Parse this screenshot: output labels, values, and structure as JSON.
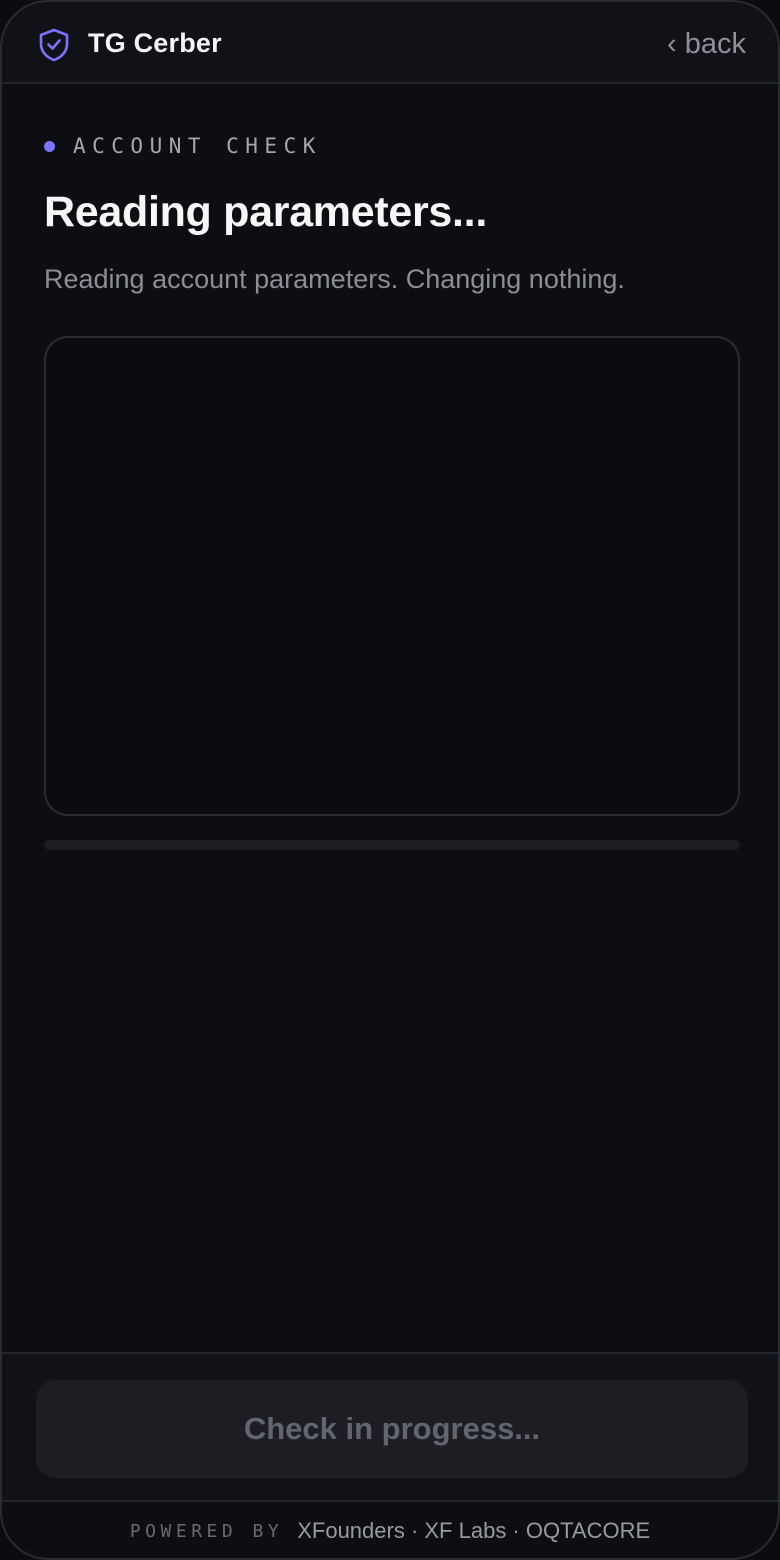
{
  "app": {
    "name": "TG Cerber",
    "back_label": "‹ back",
    "brand_icon": "shield-check-icon",
    "accent_color": "#7b74ff"
  },
  "main": {
    "eyebrow": "ACCOUNT CHECK",
    "title": "Reading parameters...",
    "subtitle": "Reading account parameters. Changing nothing.",
    "progress_fraction": 0
  },
  "action": {
    "button_label": "Check in progress..."
  },
  "footer": {
    "powered_by": "POWERED BY",
    "partners": "XFounders · XF Labs · OQTACORE"
  }
}
